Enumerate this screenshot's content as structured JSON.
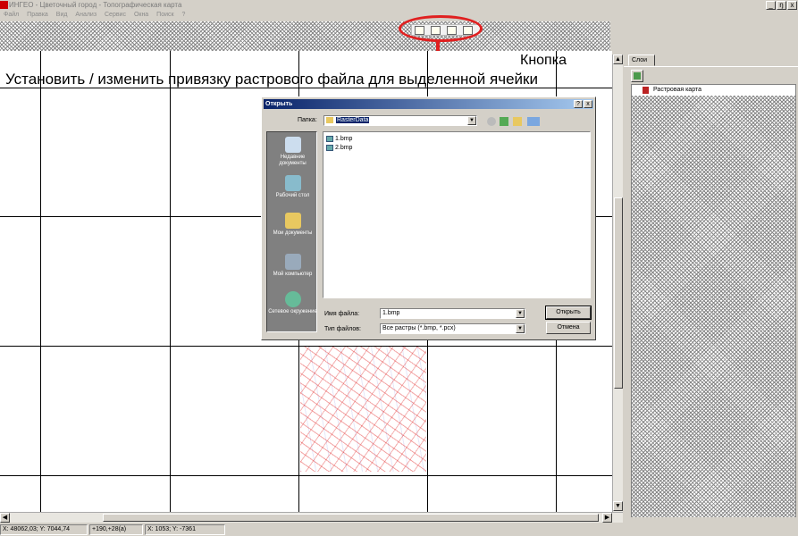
{
  "window": {
    "title": "ИНГЕО - Цветочный город - Топографическая карта",
    "buttons": {
      "minimize": "_",
      "restore": "ŋ",
      "close": "x"
    }
  },
  "menu": [
    "Файл",
    "Правка",
    "Вид",
    "Анализ",
    "Сервис",
    "Окна",
    "Поиск",
    "?"
  ],
  "annotation": {
    "button_label": "Кнопка",
    "instruction": "Установить / изменить привязку растрового файла для выделенной ячейки",
    "highlight_color": "#e02020"
  },
  "toolbar_icons": [
    "raster-bind-icon",
    "raster-add-icon",
    "raster-props-icon",
    "raster-list-icon"
  ],
  "dialog": {
    "title": "Открыть",
    "help_btn": "?",
    "close_btn": "x",
    "folder_label": "Папка:",
    "folder_value": "RasterData",
    "places": [
      {
        "label": "Недавние документы",
        "icon": "recent-docs-icon"
      },
      {
        "label": "Рабочий стол",
        "icon": "desktop-icon"
      },
      {
        "label": "Мои документы",
        "icon": "my-documents-icon"
      },
      {
        "label": "Мой компьютер",
        "icon": "my-computer-icon"
      },
      {
        "label": "Сетевое окружение",
        "icon": "network-icon"
      }
    ],
    "files": [
      "1.bmp",
      "2.bmp"
    ],
    "filename_label": "Имя файла:",
    "filename_value": "1.bmp",
    "filetype_label": "Тип файлов:",
    "filetype_value": "Все растры (*.bmp, *.pcx)",
    "open_button": "Открыть",
    "cancel_button": "Отмена"
  },
  "right_panel": {
    "tab": "Слои",
    "layers": [
      "Растровая карта"
    ]
  },
  "status_bar": {
    "coords": "X: 48062,03; Y: 7044,74",
    "offset": "+190,+28(a)",
    "cell": "X: 1053; Y: -7361"
  }
}
